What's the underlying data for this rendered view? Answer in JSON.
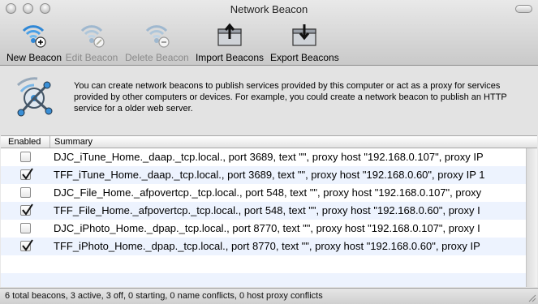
{
  "window": {
    "title": "Network Beacon"
  },
  "toolbar": {
    "items": [
      {
        "label": "New Beacon",
        "icon": "beacon-add-icon",
        "enabled": true
      },
      {
        "label": "Edit Beacon",
        "icon": "beacon-edit-icon",
        "enabled": false
      },
      {
        "label": "Delete Beacon",
        "icon": "beacon-delete-icon",
        "enabled": false
      },
      {
        "label": "Import Beacons",
        "icon": "import-box-icon",
        "enabled": true
      },
      {
        "label": "Export Beacons",
        "icon": "export-box-icon",
        "enabled": true
      }
    ]
  },
  "info": {
    "icon": "network-beacon-logo-icon",
    "text": "You can create network beacons to publish services provided by this computer or act as a proxy for services provided by other computers or devices. For example, you could create a network beacon to publish an HTTP service for a older web server."
  },
  "table": {
    "columns": {
      "enabled": "Enabled",
      "summary": "Summary"
    },
    "rows": [
      {
        "enabled": false,
        "summary": "DJC_iTune_Home._daap._tcp.local., port 3689, text \"\", proxy host \"192.168.0.107\", proxy IP"
      },
      {
        "enabled": true,
        "summary": "TFF_iTune_Home._daap._tcp.local., port 3689, text \"\", proxy host \"192.168.0.60\", proxy IP 1"
      },
      {
        "enabled": false,
        "summary": "DJC_File_Home._afpovertcp._tcp.local., port 548, text \"\", proxy host \"192.168.0.107\", proxy"
      },
      {
        "enabled": true,
        "summary": "TFF_File_Home._afpovertcp._tcp.local., port 548, text \"\", proxy host \"192.168.0.60\", proxy I"
      },
      {
        "enabled": false,
        "summary": "DJC_iPhoto_Home._dpap._tcp.local., port 8770, text \"\", proxy host \"192.168.0.107\", proxy I"
      },
      {
        "enabled": true,
        "summary": "TFF_iPhoto_Home._dpap._tcp.local., port 8770, text \"\", proxy host \"192.168.0.60\", proxy IP"
      }
    ]
  },
  "status": {
    "text": "6 total beacons, 3 active, 3 off, 0 starting, 0 name conflicts, 0 host proxy conflicts"
  },
  "colors": {
    "accent_blue": "#3a8fd6",
    "row_alt": "#edf3fe"
  }
}
